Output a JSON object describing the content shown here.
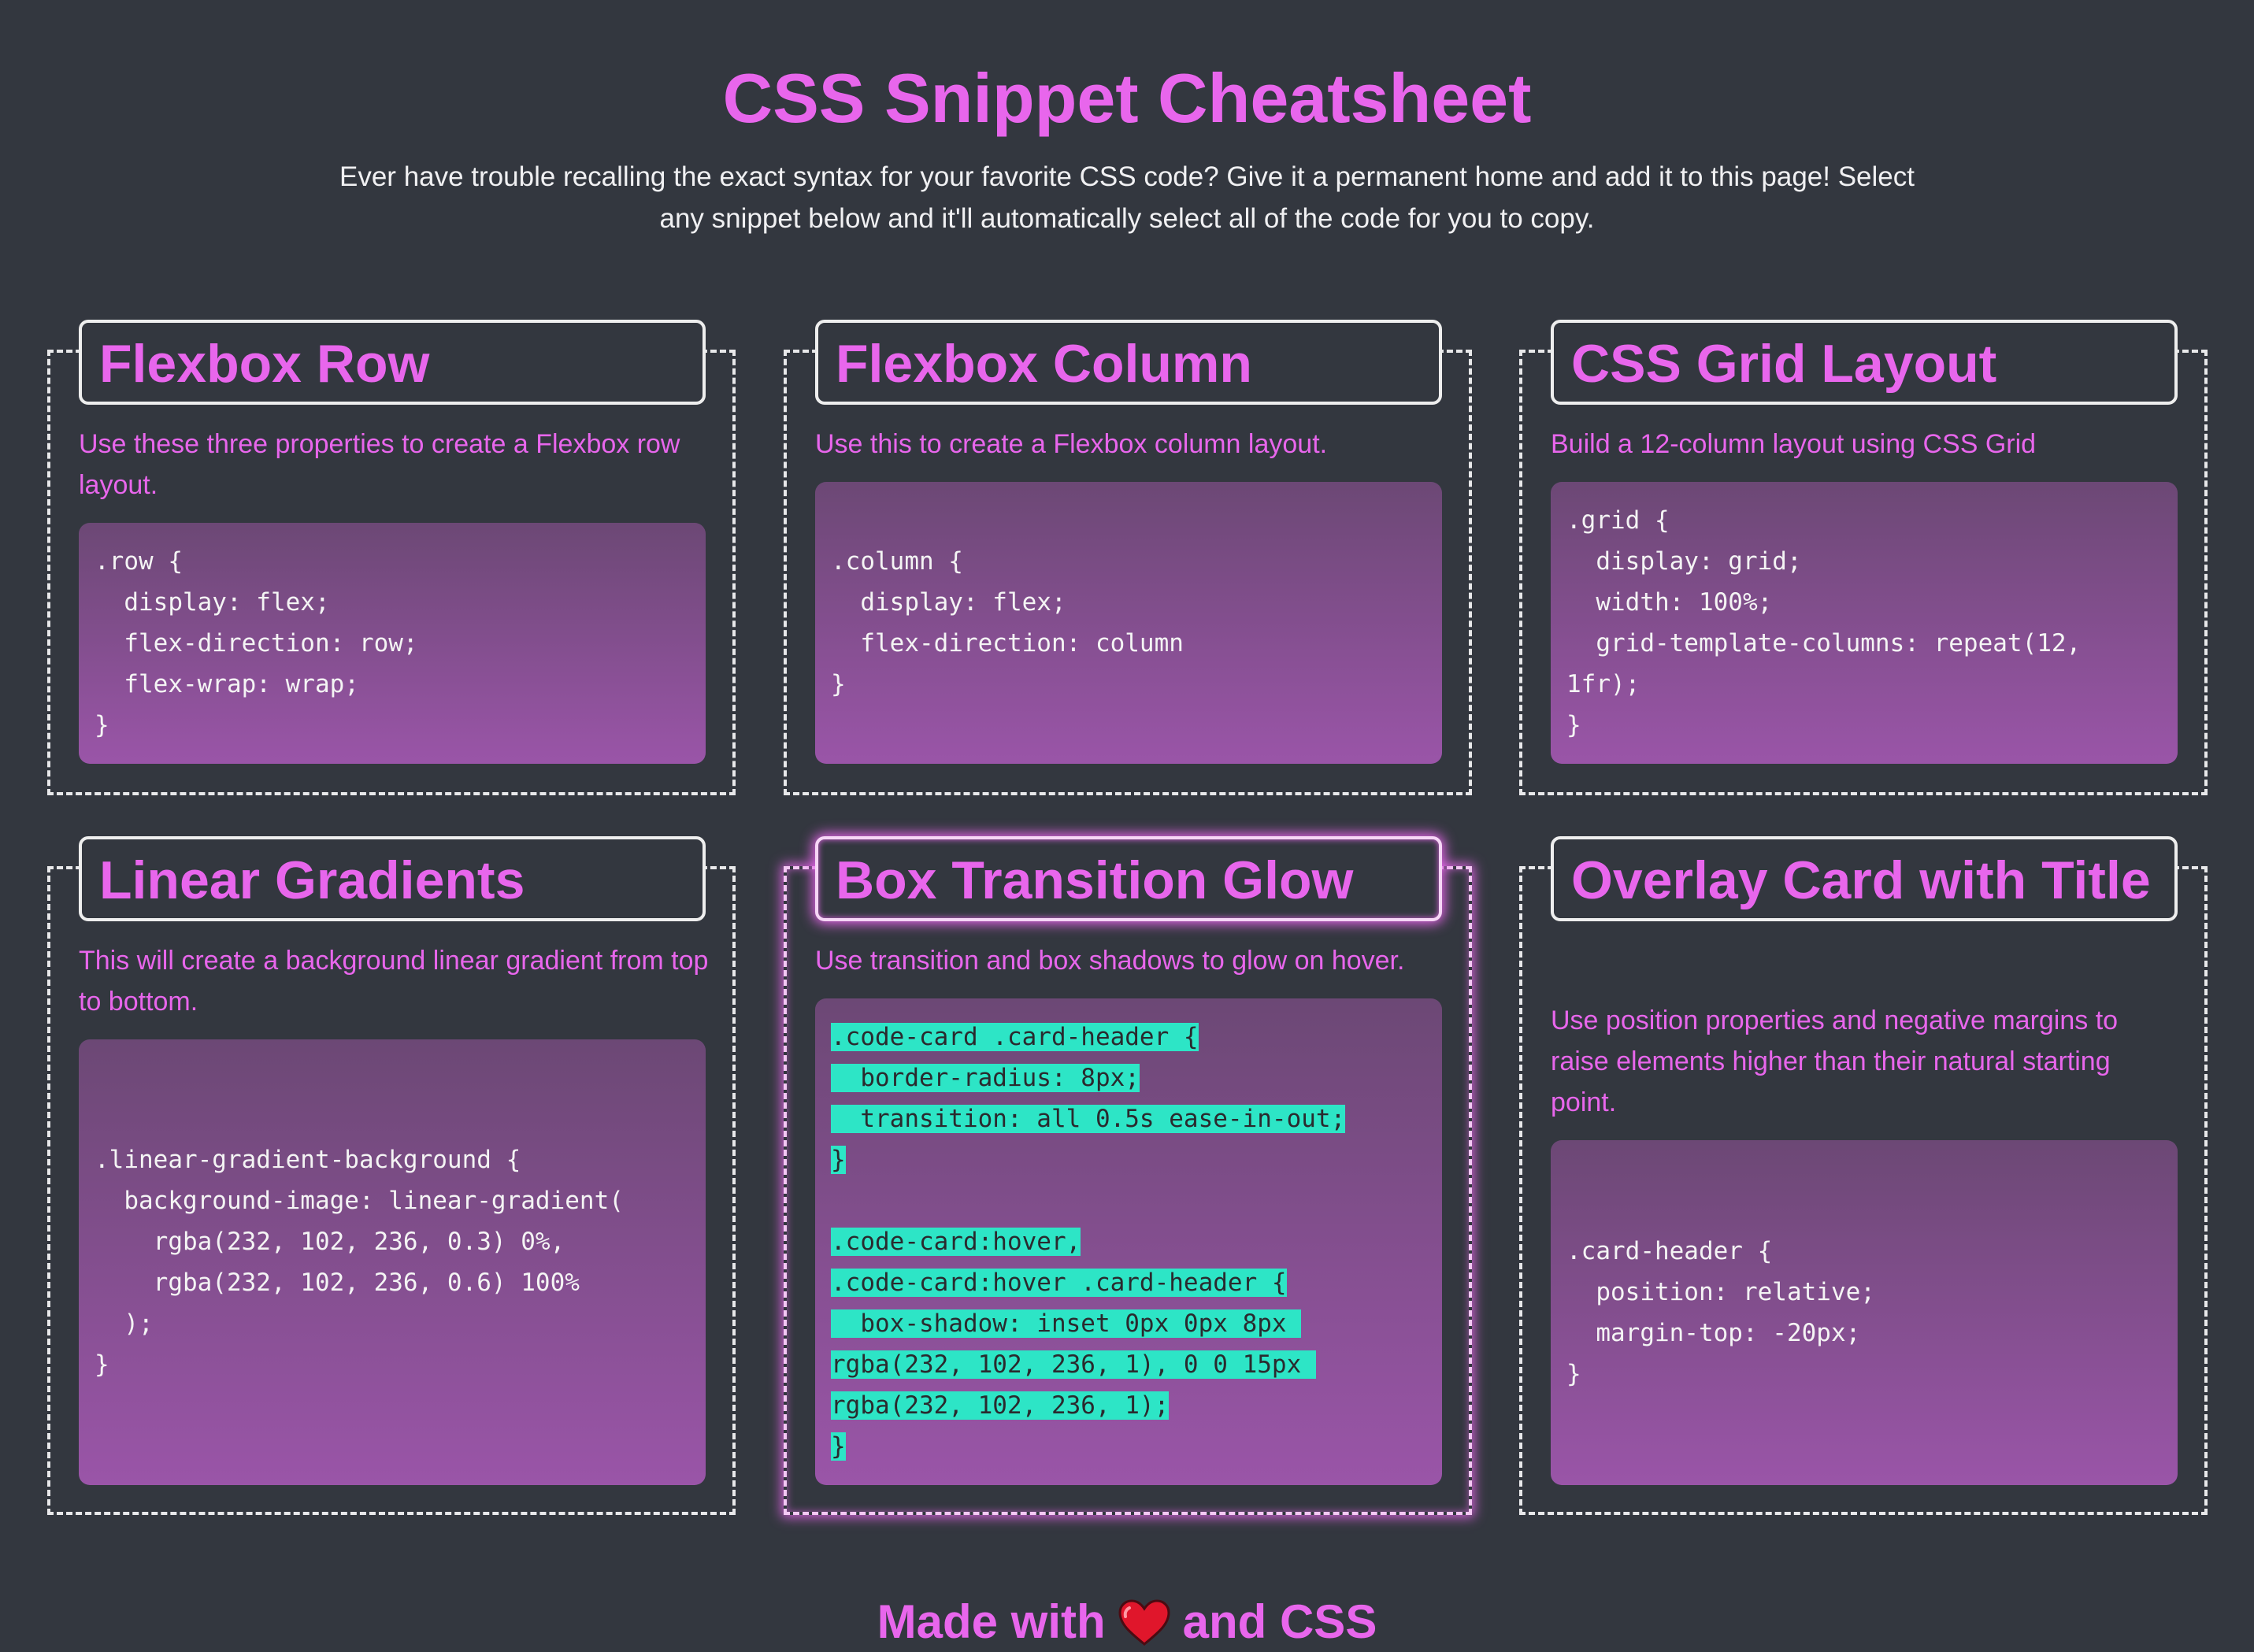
{
  "header": {
    "title": "CSS Snippet Cheatsheet",
    "intro": "Ever have trouble recalling the exact syntax for your favorite CSS code? Give it a permanent home and add it to this page! Select any snippet below and it'll automatically select all of the code for you to copy."
  },
  "cards": [
    {
      "title": "Flexbox Row",
      "description": "Use these three properties to create a Flexbox row layout.",
      "code": ".row {\n  display: flex;\n  flex-direction: row;\n  flex-wrap: wrap;\n}"
    },
    {
      "title": "Flexbox Column",
      "description": "Use this to create a Flexbox column layout.",
      "code": ".column {\n  display: flex;\n  flex-direction: column\n}"
    },
    {
      "title": "CSS Grid Layout",
      "description": "Build a 12-column layout using CSS Grid",
      "code": ".grid {\n  display: grid;\n  width: 100%;\n  grid-template-columns: repeat(12, 1fr);\n}"
    },
    {
      "title": "Linear Gradients",
      "description": "This will create a background linear gradient from top to bottom.",
      "code": ".linear-gradient-background {\n  background-image: linear-gradient(\n    rgba(232, 102, 236, 0.3) 0%,\n    rgba(232, 102, 236, 0.6) 100%\n  );\n}"
    },
    {
      "title": "Box Transition Glow",
      "description": "Use transition and box shadows to glow on hover.",
      "code": ".code-card .card-header {\n  border-radius: 8px;\n  transition: all 0.5s ease-in-out;\n}\n\n.code-card:hover,\n.code-card:hover .card-header {\n  box-shadow: inset 0px 0px 8px rgba(232, 102, 236, 1), 0 0 15px rgba(232, 102, 236, 1);\n}",
      "state": "hovered-selected"
    },
    {
      "title": "Overlay Card with Title",
      "description": "Use position properties and negative margins to raise elements higher than their natural starting point.",
      "code": ".card-header {\n  position: relative;\n  margin-top: -20px;\n}"
    }
  ],
  "footer": {
    "prefix": "Made with",
    "suffix": "and CSS",
    "icon": "heart-icon"
  },
  "colors": {
    "background": "#33373f",
    "accent": "#e866ec",
    "selection": "#2de5c6",
    "code_gradient_top": "#6c4875",
    "code_gradient_bottom": "#9a55a8"
  }
}
